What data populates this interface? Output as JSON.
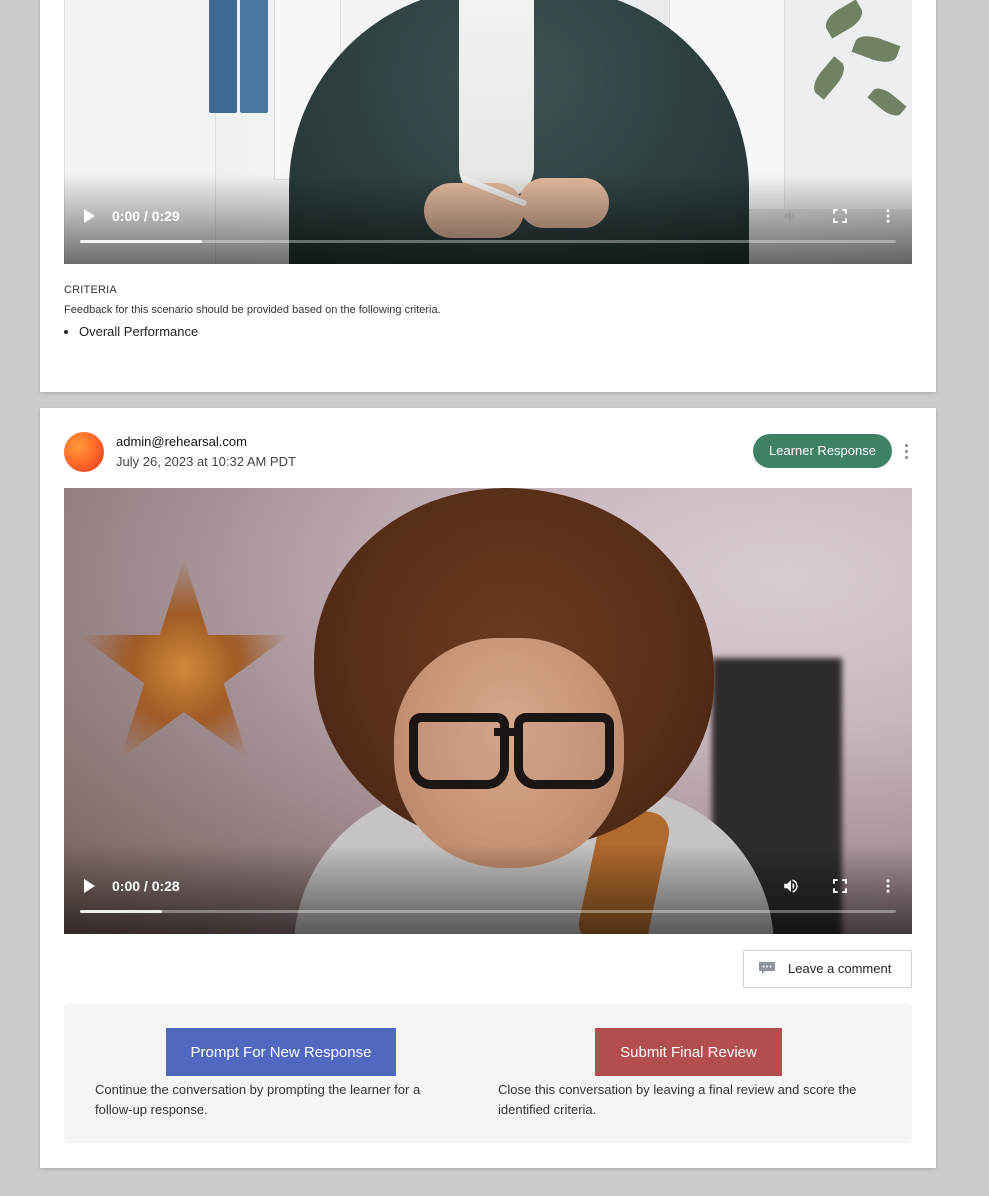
{
  "top_card": {
    "video": {
      "time": "0:00 / 0:29",
      "progress": 0.15,
      "state": "paused"
    },
    "criteria": {
      "heading": "CRITERIA",
      "description": "Feedback for this scenario should be provided based on the following criteria.",
      "items": [
        "Overall Performance"
      ]
    }
  },
  "bottom_card": {
    "author": {
      "email": "admin@rehearsal.com",
      "date": "July 26, 2023 at 10:32 AM PDT"
    },
    "badge": "Learner Response",
    "video": {
      "time": "0:00 / 0:28",
      "progress": 0.1,
      "state": "paused"
    },
    "comment_button": "Leave a comment",
    "actions": {
      "prompt_button": "Prompt For New Response",
      "prompt_help": "Continue the conversation by prompting the learner for a follow-up response.",
      "submit_button": "Submit Final Review",
      "submit_help": "Close this conversation by leaving a final review and score the identified criteria."
    }
  },
  "colors": {
    "badge": "#3f8165",
    "prompt_button": "#5168c0",
    "submit_button": "#b24e4d",
    "page_bg": "#cbcbcd"
  },
  "icons": [
    "play-icon",
    "volume-icon",
    "fullscreen-icon",
    "more-options-icon",
    "comment-icon",
    "kebab-menu-icon"
  ]
}
